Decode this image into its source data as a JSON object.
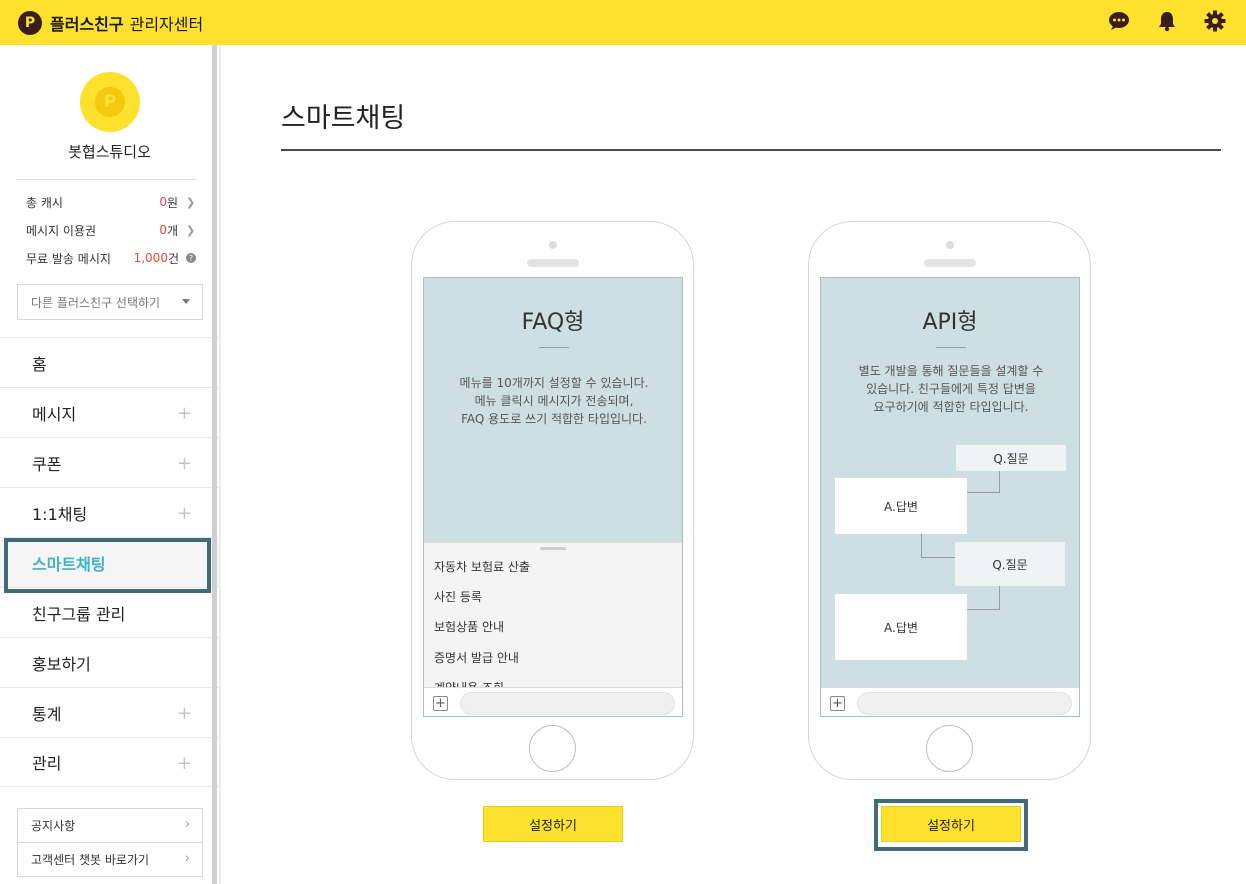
{
  "topbar": {
    "logo_glyph": "P",
    "brand": "플러스친구",
    "brand_sub": "관리자센터",
    "icons": [
      "chat-icon",
      "bell-icon",
      "gear-icon"
    ]
  },
  "sidebar": {
    "profile_name": "봇협스튜디오",
    "stats": [
      {
        "label": "총 캐시",
        "value": "0",
        "unit": "원"
      },
      {
        "label": "메시지 이용권",
        "value": "0",
        "unit": "개"
      },
      {
        "label": "무료 발송 메시지",
        "value": "1,000",
        "unit": "건"
      }
    ],
    "select_placeholder": "다른 플러스친구 선택하기",
    "menu": [
      {
        "label": "홈",
        "expandable": false
      },
      {
        "label": "메시지",
        "expandable": true
      },
      {
        "label": "쿠폰",
        "expandable": true
      },
      {
        "label": "1:1채팅",
        "expandable": true
      },
      {
        "label": "스마트채팅",
        "expandable": false,
        "active": true
      },
      {
        "label": "친구그룹 관리",
        "expandable": false
      },
      {
        "label": "홍보하기",
        "expandable": false
      },
      {
        "label": "통계",
        "expandable": true
      },
      {
        "label": "관리",
        "expandable": true
      }
    ],
    "plus_glyph": "+",
    "footer_links": [
      "공지사항",
      "고객센터 챗봇 바로가기"
    ]
  },
  "main": {
    "page_title": "스마트채팅",
    "faq": {
      "title": "FAQ형",
      "desc_lines": [
        "메뉴를 10개까지 설정할 수 있습니다.",
        "메뉴 클릭시 메시지가 전송되며,",
        "FAQ 용도로 쓰기 적합한 타입입니다."
      ],
      "menu_items": [
        "자동차 보험료 산출",
        "사진 등록",
        "보험상품 안내",
        "증명서 발급 안내",
        "계약내용 조회"
      ],
      "button": "설정하기"
    },
    "api": {
      "title": "API형",
      "desc_lines": [
        "별도 개발을 통해 질문들을 설계할 수",
        "있습니다. 친구들에게 특정 답변을",
        "요구하기에 적합한 타입입니다."
      ],
      "question_label": "Q.질문",
      "answer_label": "A.답변",
      "button": "설정하기"
    },
    "input_plus": "+"
  },
  "colors": {
    "brand_yellow": "#fde12d",
    "active_menu": "#3eb5c6",
    "highlight_frame": "#426b79",
    "screen_bg": "#cddfe2",
    "stat_value": "#e0483c"
  }
}
